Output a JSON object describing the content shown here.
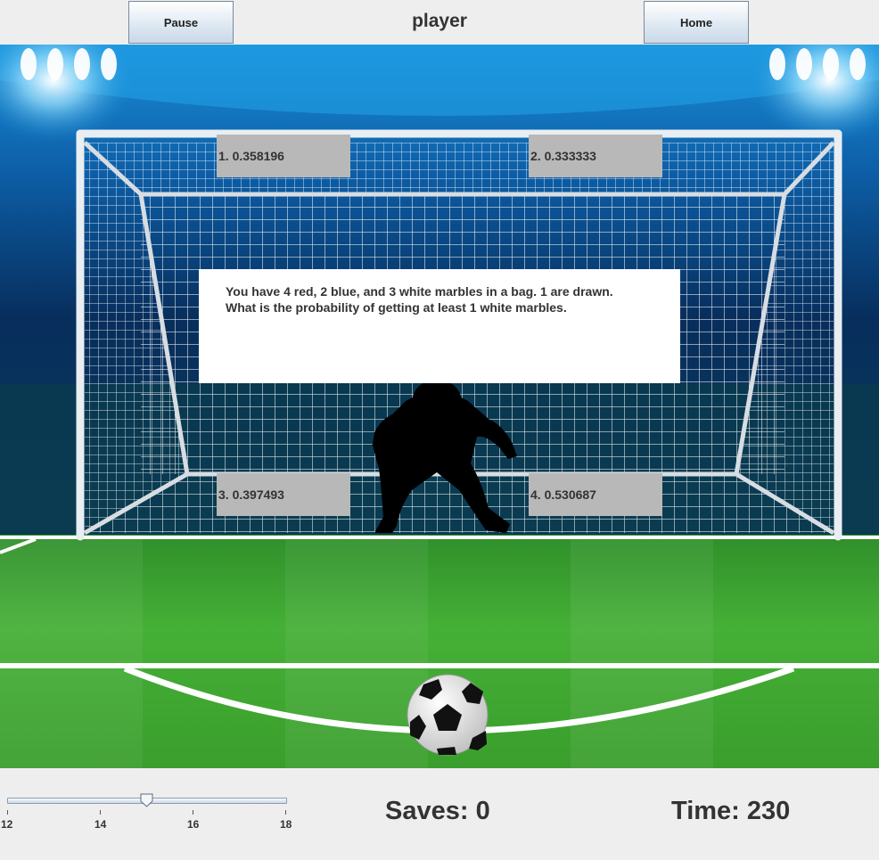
{
  "header": {
    "pause_label": "Pause",
    "title": "player",
    "home_label": "Home"
  },
  "question": {
    "line1": "You have 4 red, 2 blue, and 3 white marbles in a bag. 1 are drawn.",
    "line2": "What is the probability of getting at least 1 white marbles."
  },
  "answers": [
    {
      "label": "1. 0.358196"
    },
    {
      "label": "2. 0.333333"
    },
    {
      "label": "3. 0.397493"
    },
    {
      "label": "4. 0.530687"
    }
  ],
  "slider": {
    "min": 12,
    "max": 18,
    "value": 15,
    "tick_labels": [
      "12",
      "14",
      "16",
      "18"
    ]
  },
  "status": {
    "saves": "Saves: 0",
    "time": "Time: 230"
  },
  "colors": {
    "sky_top": "#0a2a55",
    "grass": "#3fa62e",
    "answer_box": "#b8b8b8",
    "question_box": "#ffffff"
  },
  "icons": [
    "goalkeeper-silhouette-icon",
    "soccer-ball-icon",
    "stadium-light-icon"
  ]
}
